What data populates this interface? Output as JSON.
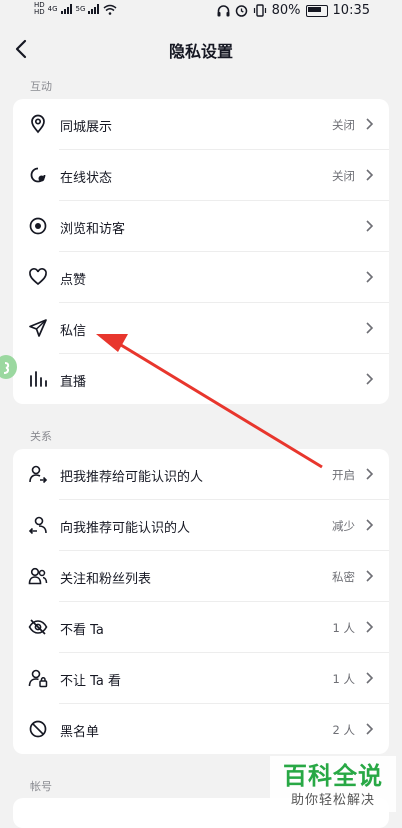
{
  "status_bar": {
    "network_labels": [
      "HD",
      "HD",
      "4G",
      "5G"
    ],
    "battery": "80%",
    "time": "10:35"
  },
  "header": {
    "title": "隐私设置"
  },
  "sections": {
    "interaction": {
      "label": "互动",
      "items": [
        {
          "label": "同城展示",
          "value": "关闭",
          "icon": "location-pin-icon"
        },
        {
          "label": "在线状态",
          "value": "关闭",
          "icon": "online-status-icon"
        },
        {
          "label": "浏览和访客",
          "value": "",
          "icon": "eye-icon"
        },
        {
          "label": "点赞",
          "value": "",
          "icon": "heart-icon"
        },
        {
          "label": "私信",
          "value": "",
          "icon": "send-icon"
        },
        {
          "label": "直播",
          "value": "",
          "icon": "live-bars-icon"
        }
      ]
    },
    "relations": {
      "label": "关系",
      "items": [
        {
          "label": "把我推荐给可能认识的人",
          "value": "开启",
          "icon": "user-share-icon"
        },
        {
          "label": "向我推荐可能认识的人",
          "value": "减少",
          "icon": "user-recommend-icon"
        },
        {
          "label": "关注和粉丝列表",
          "value": "私密",
          "icon": "users-icon"
        },
        {
          "label": "不看 Ta",
          "value": "1 人",
          "icon": "eye-off-icon"
        },
        {
          "label": "不让 Ta 看",
          "value": "1 人",
          "icon": "user-lock-icon"
        },
        {
          "label": "黑名单",
          "value": "2 人",
          "icon": "block-icon"
        }
      ]
    },
    "account": {
      "label": "帐号"
    }
  },
  "watermark": {
    "title": "百科全说",
    "subtitle": "助你轻松解决"
  },
  "colors": {
    "accent_arrow": "#e8362d",
    "watermark_green": "#28a845",
    "background": "#f2f2f2"
  }
}
